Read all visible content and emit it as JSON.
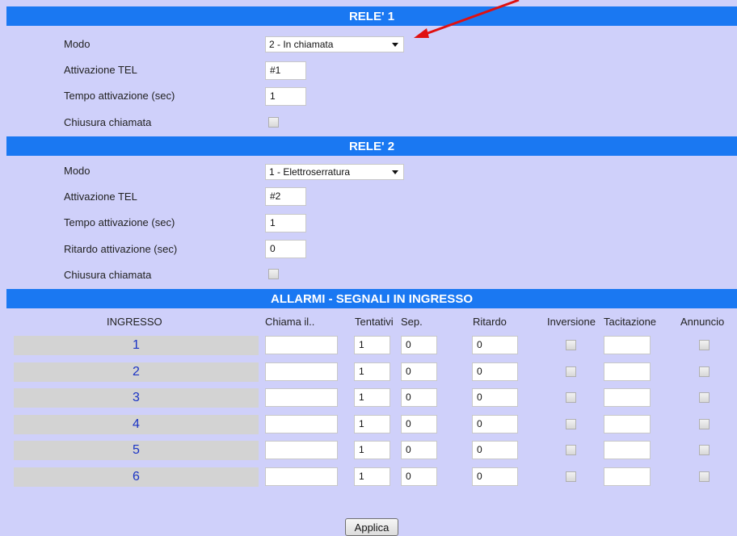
{
  "rele1": {
    "header": "RELE' 1",
    "modo_label": "Modo",
    "modo_value": "2 - In chiamata",
    "attivazione_label": "Attivazione TEL",
    "attivazione_value": "#1",
    "tempo_label": "Tempo attivazione (sec)",
    "tempo_value": "1",
    "chiusura_label": "Chiusura chiamata"
  },
  "rele2": {
    "header": "RELE' 2",
    "modo_label": "Modo",
    "modo_value": "1 - Elettroserratura",
    "attivazione_label": "Attivazione TEL",
    "attivazione_value": "#2",
    "tempo_label": "Tempo attivazione (sec)",
    "tempo_value": "1",
    "ritardo_label": "Ritardo attivazione (sec)",
    "ritardo_value": "0",
    "chiusura_label": "Chiusura chiamata"
  },
  "allarmi": {
    "header": "ALLARMI - SEGNALI IN INGRESSO",
    "columns": {
      "ingresso": "INGRESSO",
      "chiama": "Chiama il..",
      "tentativi": "Tentativi",
      "sep": "Sep.",
      "ritardo": "Ritardo",
      "inversione": "Inversione",
      "tacitazione": "Tacitazione",
      "annuncio": "Annuncio"
    },
    "rows": [
      {
        "ingresso": "1",
        "chiama": "",
        "tentativi": "1",
        "sep": "0",
        "ritardo": "0",
        "tacitazione": ""
      },
      {
        "ingresso": "2",
        "chiama": "",
        "tentativi": "1",
        "sep": "0",
        "ritardo": "0",
        "tacitazione": ""
      },
      {
        "ingresso": "3",
        "chiama": "",
        "tentativi": "1",
        "sep": "0",
        "ritardo": "0",
        "tacitazione": ""
      },
      {
        "ingresso": "4",
        "chiama": "",
        "tentativi": "1",
        "sep": "0",
        "ritardo": "0",
        "tacitazione": ""
      },
      {
        "ingresso": "5",
        "chiama": "",
        "tentativi": "1",
        "sep": "0",
        "ritardo": "0",
        "tacitazione": ""
      },
      {
        "ingresso": "6",
        "chiama": "",
        "tentativi": "1",
        "sep": "0",
        "ritardo": "0",
        "tacitazione": ""
      }
    ]
  },
  "applica_label": "Applica",
  "colors": {
    "background": "#cfd0fa",
    "header": "#1a78f2",
    "ingresso_cell": "#d3d3d3",
    "ingresso_text": "#1a33c4",
    "annotation_arrow": "#e01010"
  }
}
